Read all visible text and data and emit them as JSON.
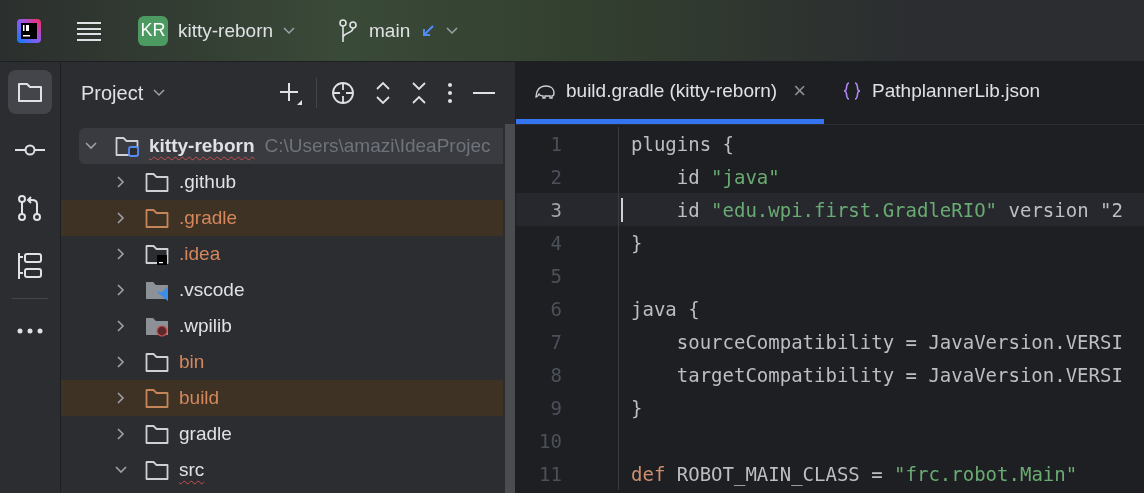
{
  "header": {
    "project_badge": "KR",
    "project_name": "kitty-reborn",
    "branch": "main"
  },
  "tool_stripe": [
    {
      "kind": "folder",
      "selected": true
    },
    {
      "kind": "commit",
      "selected": false
    },
    {
      "kind": "pulls",
      "selected": false
    },
    {
      "kind": "structure",
      "selected": false
    },
    {
      "kind": "more",
      "selected": false
    }
  ],
  "project_panel": {
    "title": "Project",
    "tree": [
      {
        "name": "kitty-reborn",
        "path": "C:\\Users\\amazi\\IdeaProjec",
        "kind": "module",
        "expanded": true,
        "selected": true,
        "typo": true,
        "ignored": false,
        "excluded": false,
        "children": [
          {
            "name": ".github",
            "kind": "plain",
            "expanded": false,
            "selected": false,
            "typo": false,
            "ignored": false,
            "excluded": false
          },
          {
            "name": ".gradle",
            "kind": "plain",
            "expanded": false,
            "selected": false,
            "typo": false,
            "ignored": true,
            "excluded": true
          },
          {
            "name": ".idea",
            "kind": "idea",
            "expanded": false,
            "selected": false,
            "typo": false,
            "ignored": true,
            "excluded": false
          },
          {
            "name": ".vscode",
            "kind": "vscode",
            "expanded": false,
            "selected": false,
            "typo": false,
            "ignored": false,
            "excluded": false
          },
          {
            "name": ".wpilib",
            "kind": "wpilib",
            "expanded": false,
            "selected": false,
            "typo": false,
            "ignored": false,
            "excluded": false
          },
          {
            "name": "bin",
            "kind": "plain",
            "expanded": false,
            "selected": false,
            "typo": false,
            "ignored": true,
            "excluded": false
          },
          {
            "name": "build",
            "kind": "plain",
            "expanded": false,
            "selected": false,
            "typo": false,
            "ignored": true,
            "excluded": true
          },
          {
            "name": "gradle",
            "kind": "plain",
            "expanded": false,
            "selected": false,
            "typo": false,
            "ignored": false,
            "excluded": false
          },
          {
            "name": "src",
            "kind": "plain",
            "expanded": true,
            "selected": false,
            "typo": true,
            "ignored": false,
            "excluded": false
          }
        ]
      }
    ]
  },
  "editor": {
    "tabs": [
      {
        "label": "build.gradle (kitty-reborn)",
        "kind": "gradle",
        "selected": true,
        "close": "×"
      },
      {
        "label": "PathplannerLib.json",
        "kind": "json",
        "selected": false
      }
    ],
    "lines": [
      {
        "number": "1",
        "current": false,
        "tokens": [
          {
            "kind": "plain",
            "text": "plugins {"
          }
        ]
      },
      {
        "number": "2",
        "current": false,
        "tokens": [
          {
            "kind": "plain",
            "text": "    id "
          },
          {
            "kind": "string",
            "text": "\"java\""
          }
        ]
      },
      {
        "number": "3",
        "current": true,
        "tokens": [
          {
            "kind": "plain",
            "text": "    id "
          },
          {
            "kind": "string",
            "text": "\"edu.wpi.first.GradleRIO\""
          },
          {
            "kind": "plain",
            "text": " version \"2"
          }
        ]
      },
      {
        "number": "4",
        "current": false,
        "tokens": [
          {
            "kind": "plain",
            "text": "}"
          }
        ]
      },
      {
        "number": "5",
        "current": false
      },
      {
        "number": "6",
        "current": false,
        "tokens": [
          {
            "kind": "plain",
            "text": "java {"
          }
        ]
      },
      {
        "number": "7",
        "current": false,
        "tokens": [
          {
            "kind": "plain",
            "text": "    sourceCompatibility = JavaVersion.VERSI"
          }
        ]
      },
      {
        "number": "8",
        "current": false,
        "tokens": [
          {
            "kind": "plain",
            "text": "    targetCompatibility = JavaVersion.VERSI"
          }
        ]
      },
      {
        "number": "9",
        "current": false,
        "tokens": [
          {
            "kind": "plain",
            "text": "}"
          }
        ]
      },
      {
        "number": "10",
        "current": false
      },
      {
        "number": "11",
        "current": false,
        "tokens": [
          {
            "kind": "keyword",
            "text": "def"
          },
          {
            "kind": "plain",
            "text": " ROBOT_MAIN_CLASS = "
          },
          {
            "kind": "string",
            "text": "\"frc.robot.Main\""
          }
        ]
      }
    ]
  }
}
